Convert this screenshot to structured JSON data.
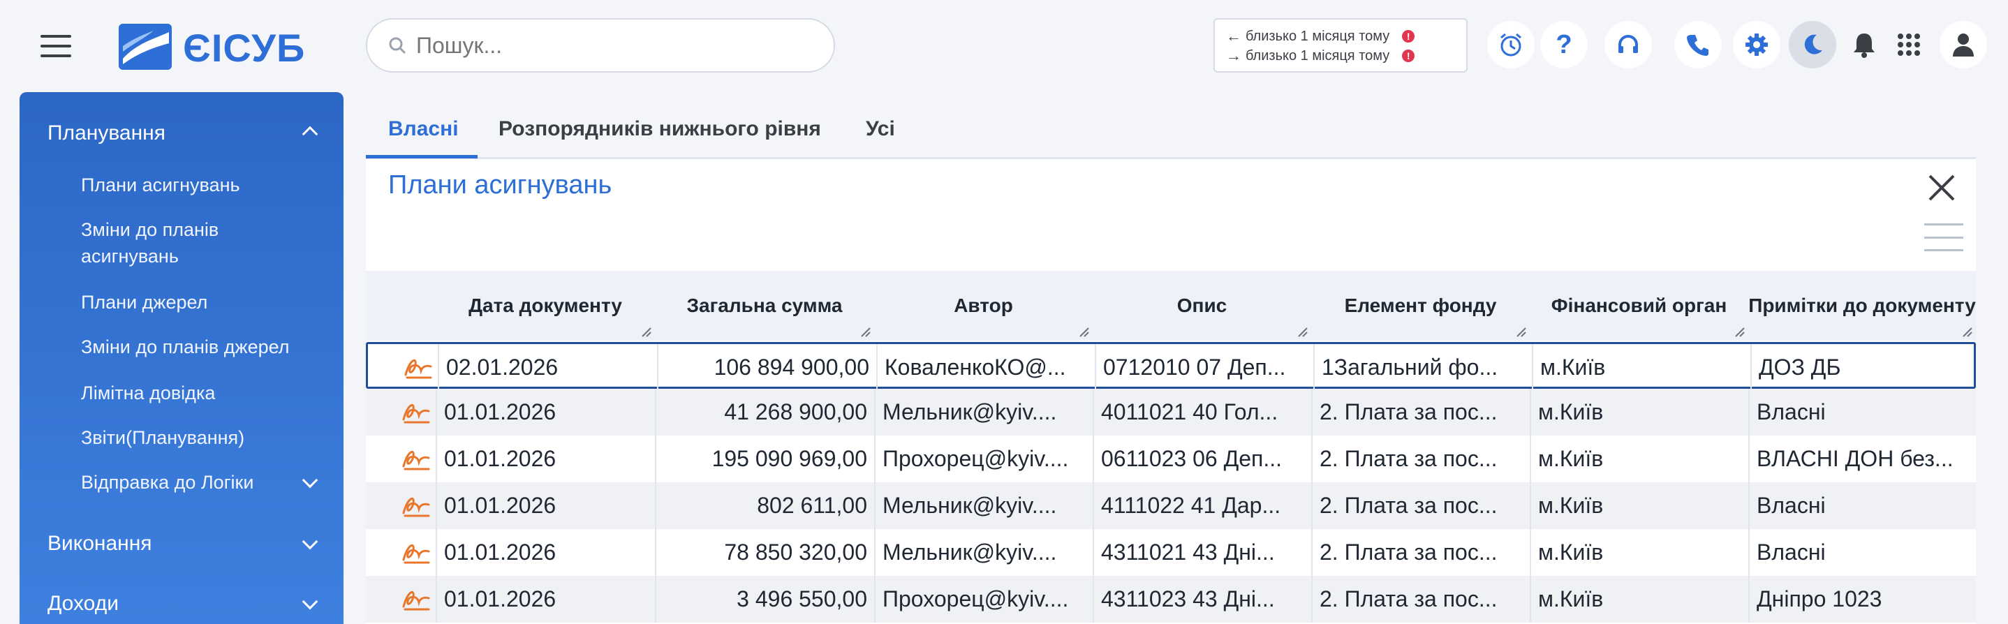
{
  "app": {
    "name": "ЄІСУБ"
  },
  "search": {
    "placeholder": "Пошук..."
  },
  "notifications": [
    {
      "direction": "left",
      "text": "близько 1 місяця тому",
      "badge": "!"
    },
    {
      "direction": "right",
      "text": "близько 1 місяця тому",
      "badge": "!"
    }
  ],
  "topbar_icons": [
    "alarm-clock-icon",
    "help-icon",
    "headset-icon",
    "phone-icon",
    "gear-icon",
    "moon-icon",
    "bell-icon",
    "apps-grid-icon",
    "user-icon"
  ],
  "colors": {
    "accent": "#2d6fd6",
    "sidebar": "#3a78d6",
    "badge": "#e0364f",
    "signature": "#e8762b"
  },
  "sidebar": {
    "sections": [
      {
        "label": "Планування",
        "expanded": true
      },
      {
        "label": "Виконання",
        "expanded": false
      },
      {
        "label": "Доходи",
        "expanded": false
      }
    ],
    "items": [
      {
        "label": "Плани асигнувань"
      },
      {
        "label": "Зміни до планів асигнувань"
      },
      {
        "label": "Плани джерел"
      },
      {
        "label": "Зміни до планів джерел"
      },
      {
        "label": "Лімітна довідка"
      },
      {
        "label": "Звіти(Планування)"
      },
      {
        "label": "Відправка до Логіки"
      }
    ]
  },
  "tabs": [
    {
      "label": "Власні",
      "active": true
    },
    {
      "label": "Розпорядників нижнього рівня",
      "active": false
    },
    {
      "label": "Усі",
      "active": false
    }
  ],
  "panel": {
    "title": "Плани асигнувань"
  },
  "table": {
    "columns": [
      "Дата документу",
      "Загальна сумма",
      "Автор",
      "Опис",
      "Елемент фонду",
      "Фінансовий орган",
      "Примітки до документу"
    ],
    "rows": [
      {
        "date": "02.01.2026",
        "sum": "106 894 900,00",
        "author": "КоваленкоКО@...",
        "desc": "0712010 07 Деп...",
        "fund": "1Загальний фо...",
        "org": "м.Київ",
        "notes": "ДОЗ ДБ"
      },
      {
        "date": "01.01.2026",
        "sum": "41 268 900,00",
        "author": "Мельник@kyiv....",
        "desc": "4011021 40 Гол...",
        "fund": "2. Плата за пос...",
        "org": "м.Київ",
        "notes": "Власні"
      },
      {
        "date": "01.01.2026",
        "sum": "195 090 969,00",
        "author": "Прохорец@kyiv....",
        "desc": "0611023 06 Деп...",
        "fund": "2. Плата за пос...",
        "org": "м.Київ",
        "notes": "ВЛАСНІ ДОН без..."
      },
      {
        "date": "01.01.2026",
        "sum": "802 611,00",
        "author": "Мельник@kyiv....",
        "desc": "4111022 41 Дар...",
        "fund": "2. Плата за пос...",
        "org": "м.Київ",
        "notes": "Власні"
      },
      {
        "date": "01.01.2026",
        "sum": "78 850 320,00",
        "author": "Мельник@kyiv....",
        "desc": "4311021 43 Дні...",
        "fund": "2. Плата за пос...",
        "org": "м.Київ",
        "notes": "Власні"
      },
      {
        "date": "01.01.2026",
        "sum": "3 496 550,00",
        "author": "Прохорец@kyiv....",
        "desc": "4311023 43 Дні...",
        "fund": "2. Плата за пос...",
        "org": "м.Київ",
        "notes": "Дніпро 1023"
      }
    ]
  }
}
